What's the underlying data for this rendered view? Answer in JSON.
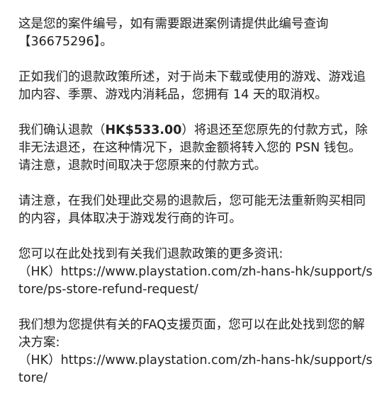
{
  "message": {
    "case_line": "这是您的案件编号，如有需要跟进案例请提供此编号查询",
    "case_number": "【36675296】。",
    "policy_paragraph": "正如我们的退款政策所述，对于尚未下载或使用的游戏、游戏追加内容、季票、游戏内消耗品，您拥有 14 天的取消权。",
    "refund_prefix": "我们确认退款（",
    "refund_amount": "HK$533.00",
    "refund_suffix": "）将退还至您原先的付款方式，除非无法退还，在这种情况下，退款金额将转入您的 PSN 钱包。请注意，退款时间取决于您原来的付款方式。",
    "repurchase_paragraph": "请注意，在我们处理此交易的退款后，您可能无法重新购买相同的内容，具体取决于游戏发行商的许可。",
    "refund_policy_intro": "您可以在此处找到有关我们退款政策的更多资讯:",
    "refund_policy_region": "（HK）",
    "refund_policy_url": "https://www.playstation.com/zh-hans-hk/support/store/ps-store-refund-request/",
    "faq_intro": "我们想为您提供有关的FAQ支援页面，您可以在此处找到您的解决方案:",
    "faq_region": "（HK）",
    "faq_url": "https://www.playstation.com/zh-hans-hk/support/store/"
  }
}
